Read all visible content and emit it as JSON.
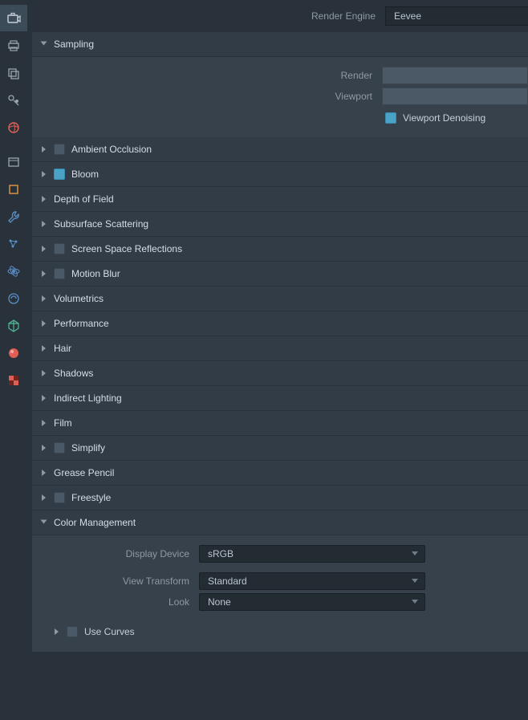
{
  "topbar": {
    "engine_label": "Render Engine",
    "engine_value": "Eevee"
  },
  "sampling": {
    "title": "Sampling",
    "render_label": "Render",
    "viewport_label": "Viewport",
    "denoise_label": "Viewport Denoising",
    "denoise_checked": true
  },
  "sections": [
    {
      "title": "Ambient Occlusion",
      "has_checkbox": true,
      "checked": false
    },
    {
      "title": "Bloom",
      "has_checkbox": true,
      "checked": true
    },
    {
      "title": "Depth of Field",
      "has_checkbox": false
    },
    {
      "title": "Subsurface Scattering",
      "has_checkbox": false
    },
    {
      "title": "Screen Space Reflections",
      "has_checkbox": true,
      "checked": false
    },
    {
      "title": "Motion Blur",
      "has_checkbox": true,
      "checked": false
    },
    {
      "title": "Volumetrics",
      "has_checkbox": false
    },
    {
      "title": "Performance",
      "has_checkbox": false
    },
    {
      "title": "Hair",
      "has_checkbox": false
    },
    {
      "title": "Shadows",
      "has_checkbox": false
    },
    {
      "title": "Indirect Lighting",
      "has_checkbox": false
    },
    {
      "title": "Film",
      "has_checkbox": false
    },
    {
      "title": "Simplify",
      "has_checkbox": true,
      "checked": false
    },
    {
      "title": "Grease Pencil",
      "has_checkbox": false
    },
    {
      "title": "Freestyle",
      "has_checkbox": true,
      "checked": false
    }
  ],
  "cmgmt": {
    "title": "Color Management",
    "display_device_label": "Display Device",
    "display_device_value": "sRGB",
    "view_transform_label": "View Transform",
    "view_transform_value": "Standard",
    "look_label": "Look",
    "look_value": "None",
    "use_curves_label": "Use Curves",
    "use_curves_checked": false
  },
  "icons": {
    "accent": "#e05e56"
  }
}
